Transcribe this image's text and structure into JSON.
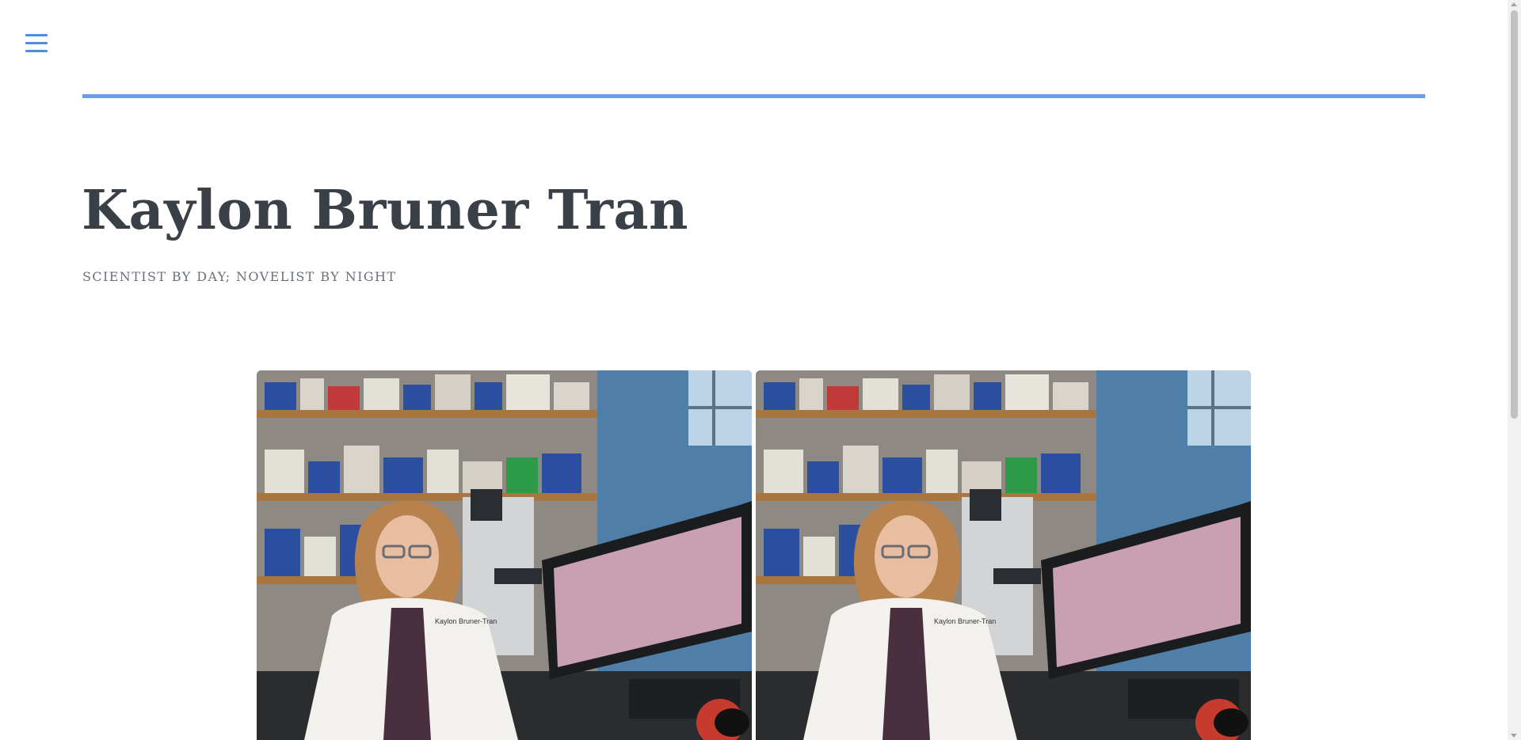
{
  "header": {
    "menu_icon": "hamburger-menu-icon",
    "accent_color": "#6a9de6"
  },
  "site": {
    "title": "Kaylon Bruner Tran",
    "tagline": "SCIENTIST BY DAY; NOVELIST BY NIGHT"
  },
  "gallery": {
    "images": [
      {
        "name": "scientist-portrait-photo-1"
      },
      {
        "name": "scientist-portrait-photo-2"
      }
    ]
  }
}
